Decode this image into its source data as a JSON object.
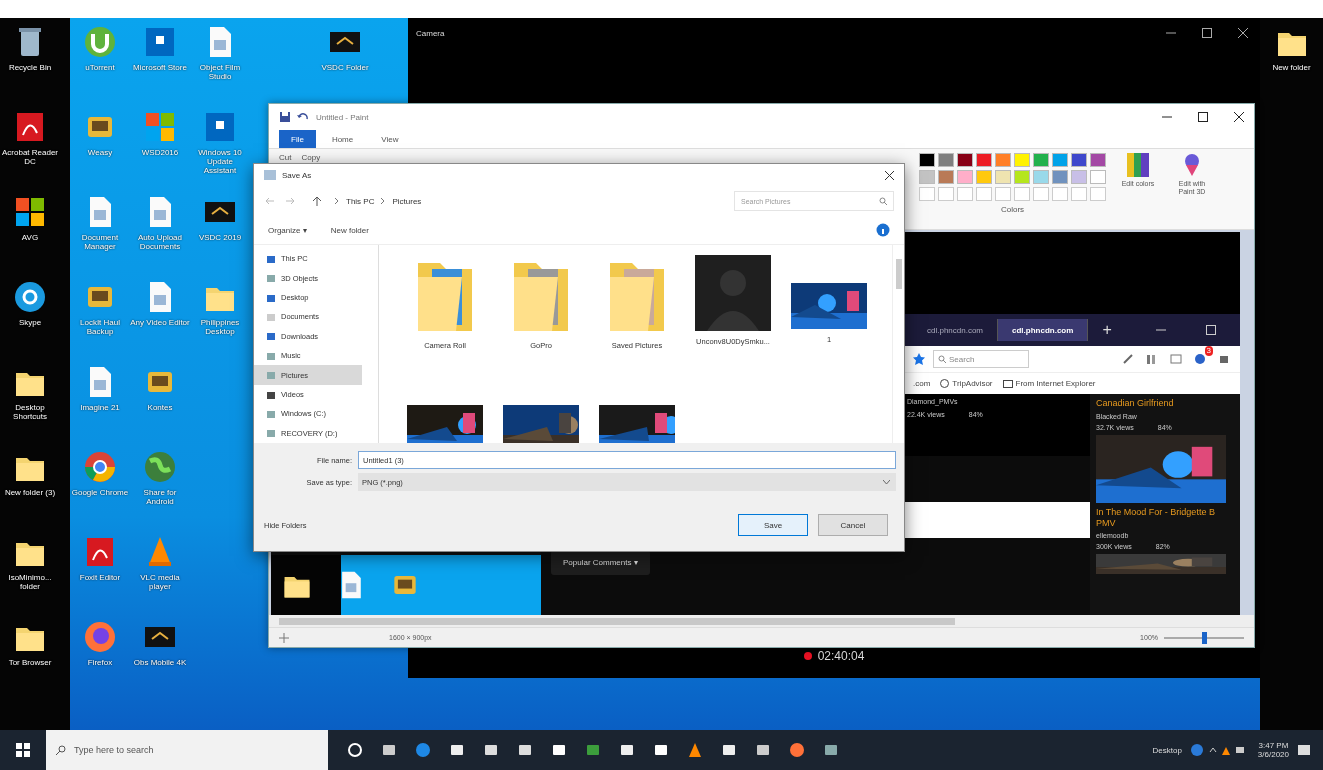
{
  "desktop": {
    "left_icons": [
      {
        "label": "Recycle Bin",
        "kind": "bin"
      },
      {
        "label": "Acrobat Reader DC",
        "kind": "pdf"
      },
      {
        "label": "AVG",
        "kind": "tiles"
      },
      {
        "label": "Skype",
        "kind": "skype"
      },
      {
        "label": "Desktop Shortcuts",
        "kind": "folder"
      },
      {
        "label": "New folder (3)",
        "kind": "folder"
      },
      {
        "label": "IsoMinimo... folder",
        "kind": "folder"
      },
      {
        "label": "Tor Browser",
        "kind": "folder"
      }
    ],
    "icons": [
      {
        "label": "uTorrent",
        "kind": "torrent"
      },
      {
        "label": "Weasy",
        "kind": "tool"
      },
      {
        "label": "Document Manager",
        "kind": "doc"
      },
      {
        "label": "LockIt Haul Backup",
        "kind": "tool"
      },
      {
        "label": "Imagine 21",
        "kind": "doc"
      },
      {
        "label": "Google Chrome",
        "kind": "chrome"
      },
      {
        "label": "Foxit Editor",
        "kind": "pdf"
      },
      {
        "label": "Firefox",
        "kind": "firefox"
      },
      {
        "label": "Microsoft Store",
        "kind": "store"
      },
      {
        "label": "WSD2016",
        "kind": "tiles"
      },
      {
        "label": "Auto Upload Documents",
        "kind": "doc"
      },
      {
        "label": "Any Video Editor",
        "kind": "doc"
      },
      {
        "label": "Kontes",
        "kind": "tool"
      },
      {
        "label": "Share for Android",
        "kind": "globe"
      },
      {
        "label": "VLC media player",
        "kind": "vlc"
      },
      {
        "label": "Obs Mobile 4K",
        "kind": "dark"
      },
      {
        "label": "Object Film Studio",
        "kind": "doc"
      },
      {
        "label": "Windows 10 Update Assistant",
        "kind": "store"
      },
      {
        "label": "VSDC 2019",
        "kind": "dark"
      },
      {
        "label": "Philippines Desktop",
        "kind": "folder"
      }
    ],
    "top_icon": {
      "label": "VSDC Folder",
      "kind": "dark"
    },
    "right_icon": {
      "label": "New folder",
      "kind": "folder"
    }
  },
  "camera": {
    "title": "Camera",
    "recording": true,
    "timer": "02:40:04"
  },
  "paint": {
    "title": "Untitled - Paint",
    "tabs": [
      {
        "label": "File",
        "selected": true
      },
      {
        "label": "Home",
        "selected": false
      },
      {
        "label": "View",
        "selected": false
      }
    ],
    "clipboard": [
      "Cut",
      "Copy"
    ],
    "palette": [
      {
        "color": "#000000"
      },
      {
        "color": "#7f7f7f"
      },
      {
        "color": "#880015"
      },
      {
        "color": "#ed1c24"
      },
      {
        "color": "#ff7f27"
      },
      {
        "color": "#fff200"
      },
      {
        "color": "#22b14c"
      },
      {
        "color": "#00a2e8"
      },
      {
        "color": "#3f48cc"
      },
      {
        "color": "#a349a4"
      },
      {
        "color": "#c3c3c3"
      },
      {
        "color": "#b97a57"
      },
      {
        "color": "#ffaec9"
      },
      {
        "color": "#ffc90e"
      },
      {
        "color": "#efe4b0"
      },
      {
        "color": "#b5e61d"
      },
      {
        "color": "#99d9ea"
      },
      {
        "color": "#7092be"
      },
      {
        "color": "#c8bfe7"
      },
      {
        "color": "#ffffff"
      }
    ],
    "colors_label": "Colors",
    "edit_colors": "Edit colors",
    "paint3d": "Edit with Paint 3D",
    "status": {
      "size": "1600 × 900px",
      "zoom": "100%",
      "level": 0.5
    }
  },
  "browser": {
    "tabs": [
      {
        "label": "cdl.phncdn.com",
        "selected": false
      },
      {
        "label": "cdl.phncdn.com",
        "selected": true
      }
    ],
    "new_tab": "+",
    "search": {
      "placeholder": "Search"
    },
    "notifications": "3",
    "bookmarks": [
      {
        "label": ".com",
        "kind": "link"
      },
      {
        "label": "TripAdvisor",
        "kind": "site"
      },
      {
        "label": "From Internet Explorer",
        "kind": "folder"
      }
    ],
    "main_video": {
      "channel": "Diamond_PMVs",
      "views": "22.4K views",
      "rating": "84%"
    },
    "comments_button": "Popular Comments ▾",
    "videos": [
      {
        "title": "Canadian Girlfriend",
        "channel": "Blacked Raw",
        "views": "32.7K views",
        "rating": "84%"
      },
      {
        "title": "In The Mood For - Bridgette B PMV",
        "channel": "ellemoodb",
        "views": "300K views",
        "rating": "82%"
      }
    ]
  },
  "save_dialog": {
    "title": "Save As",
    "path": [
      "This PC",
      "Pictures"
    ],
    "search": {
      "placeholder": "Search Pictures"
    },
    "organize": "Organize ▾",
    "new_folder": "New folder",
    "nav": [
      {
        "label": "This PC",
        "kind": "pc",
        "selected": false
      },
      {
        "label": "3D Objects",
        "kind": "cube",
        "selected": false
      },
      {
        "label": "Desktop",
        "kind": "desktop",
        "selected": false
      },
      {
        "label": "Documents",
        "kind": "docs",
        "selected": false
      },
      {
        "label": "Downloads",
        "kind": "down",
        "selected": false
      },
      {
        "label": "Music",
        "kind": "music",
        "selected": false
      },
      {
        "label": "Pictures",
        "kind": "pics",
        "selected": true
      },
      {
        "label": "Videos",
        "kind": "video",
        "selected": false
      },
      {
        "label": "Windows (C:)",
        "kind": "drive",
        "selected": false
      },
      {
        "label": "RECOVERY (D:)",
        "kind": "drive",
        "selected": false
      }
    ],
    "files": [
      {
        "name": "Camera Roll",
        "kind": "folder"
      },
      {
        "name": "GoPro",
        "kind": "folder"
      },
      {
        "name": "Saved Pictures",
        "kind": "folder"
      },
      {
        "name": "Unconv8U0DySmku...",
        "kind": "person"
      },
      {
        "name": "1",
        "kind": "screenshot"
      },
      {
        "kind": "picture"
      },
      {
        "kind": "picture"
      },
      {
        "kind": "picture"
      }
    ],
    "file_name_label": "File name:",
    "file_name": "Untitled1 (3)",
    "type_label": "Save as type:",
    "file_type": "PNG (*.png)",
    "hide_folders": "Hide Folders",
    "buttons": [
      {
        "label": "Save",
        "primary": true
      },
      {
        "label": "Cancel",
        "primary": false
      }
    ]
  },
  "taskbar": {
    "search": {
      "placeholder": "Type here to search"
    },
    "apps": [
      {
        "kind": "cortana"
      },
      {
        "kind": "taskview"
      },
      {
        "kind": "edge"
      },
      {
        "kind": "store"
      },
      {
        "kind": "mail"
      },
      {
        "kind": "mail"
      },
      {
        "kind": "amazon"
      },
      {
        "kind": "xbox"
      },
      {
        "kind": "camera"
      },
      {
        "kind": "dark"
      },
      {
        "kind": "vlc"
      },
      {
        "kind": "camera"
      },
      {
        "kind": "calc"
      },
      {
        "kind": "firefox"
      },
      {
        "kind": "paint"
      }
    ],
    "toolbar_label": "Desktop",
    "time": "3:47 PM",
    "date": "3/6/2020"
  }
}
